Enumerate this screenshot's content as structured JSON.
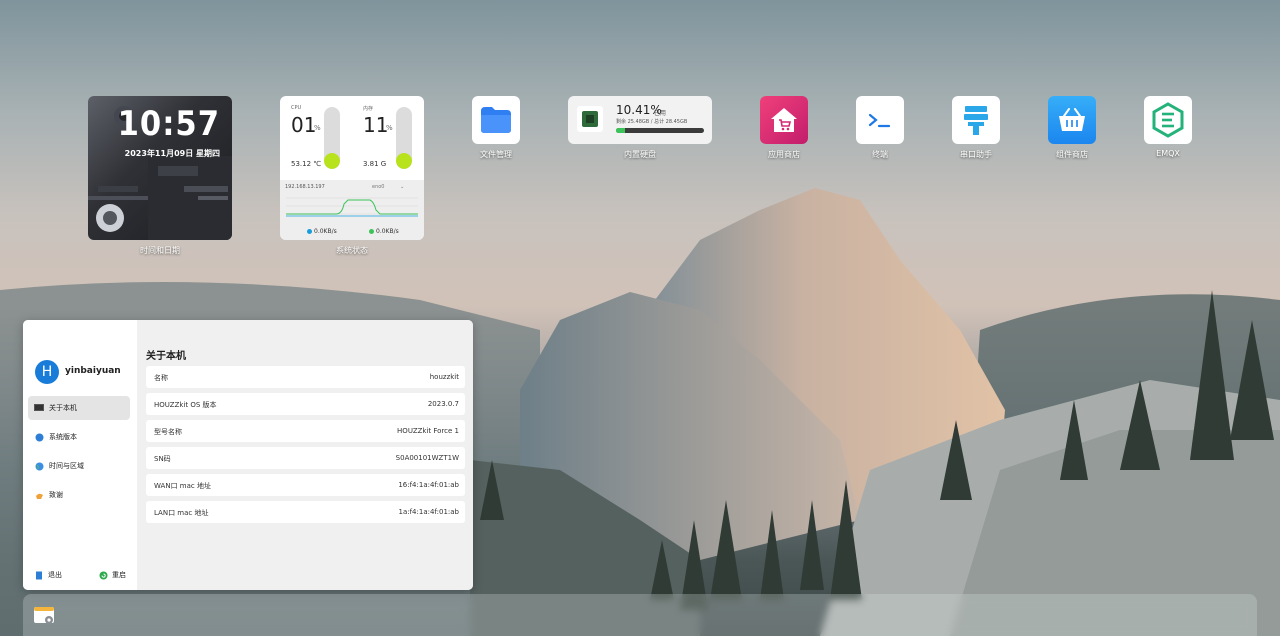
{
  "widgets": {
    "clock": {
      "time": "10:57",
      "date": "2023年11月09日 星期四",
      "label": "时间和日期"
    },
    "system_status": {
      "label": "系统状态",
      "cpu": {
        "label": "CPU",
        "value": "01",
        "unit": "%",
        "temp": "53.12 ℃",
        "level": 0.01
      },
      "memory": {
        "label": "内存",
        "value": "11",
        "unit": "%",
        "size": "3.81 G",
        "level": 0.11
      },
      "ip": "192.168.13.197",
      "interface": "eno0",
      "upload": "0.0KB/s",
      "download": "0.0KB/s"
    },
    "disk": {
      "label": "内置硬盘",
      "percent": "10.41%",
      "used_label": "已用",
      "detail": "剩余 25.48GB / 总计 28.45GB",
      "level": 0.1041
    }
  },
  "apps": [
    {
      "label": "文件管理",
      "icon": "folder-icon"
    },
    {
      "label": "应用商店",
      "icon": "app-store-icon"
    },
    {
      "label": "终端",
      "icon": "terminal-icon"
    },
    {
      "label": "串口助手",
      "icon": "serial-port-icon"
    },
    {
      "label": "组件商店",
      "icon": "component-store-icon"
    },
    {
      "label": "EMQX",
      "icon": "emqx-icon"
    }
  ],
  "about": {
    "username": "yinbaiyuan",
    "avatar_letter": "H",
    "menu": [
      {
        "label": "关于本机",
        "icon": "computer-icon"
      },
      {
        "label": "系统版本",
        "icon": "system-icon"
      },
      {
        "label": "时间与区域",
        "icon": "globe-icon"
      },
      {
        "label": "致谢",
        "icon": "thanks-icon"
      }
    ],
    "logout": "退出",
    "restart": "重启",
    "title": "关于本机",
    "rows": [
      {
        "key": "名称",
        "value": "houzzkit"
      },
      {
        "key": "HOUZZkit OS 版本",
        "value": "2023.0.7"
      },
      {
        "key": "型号名称",
        "value": "HOUZZkit Force 1"
      },
      {
        "key": "SN码",
        "value": "S0A00101WZT1W"
      },
      {
        "key": "WAN口 mac 地址",
        "value": "16:f4:1a:4f:01:ab"
      },
      {
        "key": "LAN口 mac 地址",
        "value": "1a:f4:1a:4f:01:ab"
      }
    ]
  },
  "colors": {
    "accent": "#1a7cd9",
    "meter_fill": "#b8e21c",
    "disk_fill": "#3cc35a",
    "store_pink": "#e8407a",
    "component_blue": "#2b9bf4",
    "emqx_green": "#23b37a"
  }
}
